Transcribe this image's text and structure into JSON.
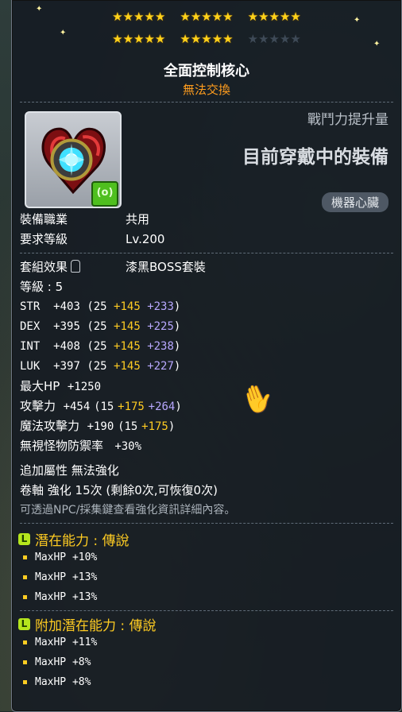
{
  "stars": {
    "row1": [
      5,
      5,
      5
    ],
    "row2_filled": [
      5,
      5
    ],
    "row2_empty": 5
  },
  "item": {
    "name": "全面控制核心",
    "trade_note": "無法交換",
    "combat_power_label": "戰鬥力提升量",
    "equipped_label": "目前穿戴中的裝備",
    "category": "機器心臟",
    "badge_text": "(o)"
  },
  "info": {
    "job_label": "裝備職業",
    "job_value": "共用",
    "level_label": "要求等級",
    "level_value": "Lv.200",
    "set_label": "套組效果",
    "set_value": "漆黑BOSS套裝",
    "grade": "等級 : 5"
  },
  "stats": [
    {
      "name": "STR",
      "total": "+403",
      "base": "(25",
      "bonus1": "+145",
      "bonus2": "+233",
      "close": ")"
    },
    {
      "name": "DEX",
      "total": "+395",
      "base": "(25",
      "bonus1": "+145",
      "bonus2": "+225",
      "close": ")"
    },
    {
      "name": "INT",
      "total": "+408",
      "base": "(25",
      "bonus1": "+145",
      "bonus2": "+238",
      "close": ")"
    },
    {
      "name": "LUK",
      "total": "+397",
      "base": "(25",
      "bonus1": "+145",
      "bonus2": "+227",
      "close": ")"
    }
  ],
  "maxhp": {
    "name": "最大HP",
    "value": "+1250"
  },
  "attack": {
    "name": "攻擊力",
    "total": "+454",
    "base": "(15",
    "bonus1": "+175",
    "bonus2": "+264",
    "close": ")"
  },
  "magic": {
    "name": "魔法攻擊力",
    "total": "+190",
    "base": "(15",
    "bonus1": "+175",
    "close": ")"
  },
  "ignore_def": {
    "name": "無視怪物防禦率",
    "value": "+30%"
  },
  "extra": {
    "attribute": "追加屬性 無法強化",
    "scroll": "卷軸 強化 15次 (剩餘0次,可恢復0次)",
    "hint": "可透過NPC/採集鍵查看強化資訊詳細內容。"
  },
  "potential": {
    "badge": "L",
    "title": "潛在能力 : 傳說",
    "lines": [
      "MaxHP +10%",
      "MaxHP +13%",
      "MaxHP +13%"
    ]
  },
  "bonus_potential": {
    "badge": "L",
    "title": "附加潛在能力 : 傳說",
    "lines": [
      "MaxHP +11%",
      "MaxHP +8%",
      "MaxHP +8%"
    ]
  }
}
